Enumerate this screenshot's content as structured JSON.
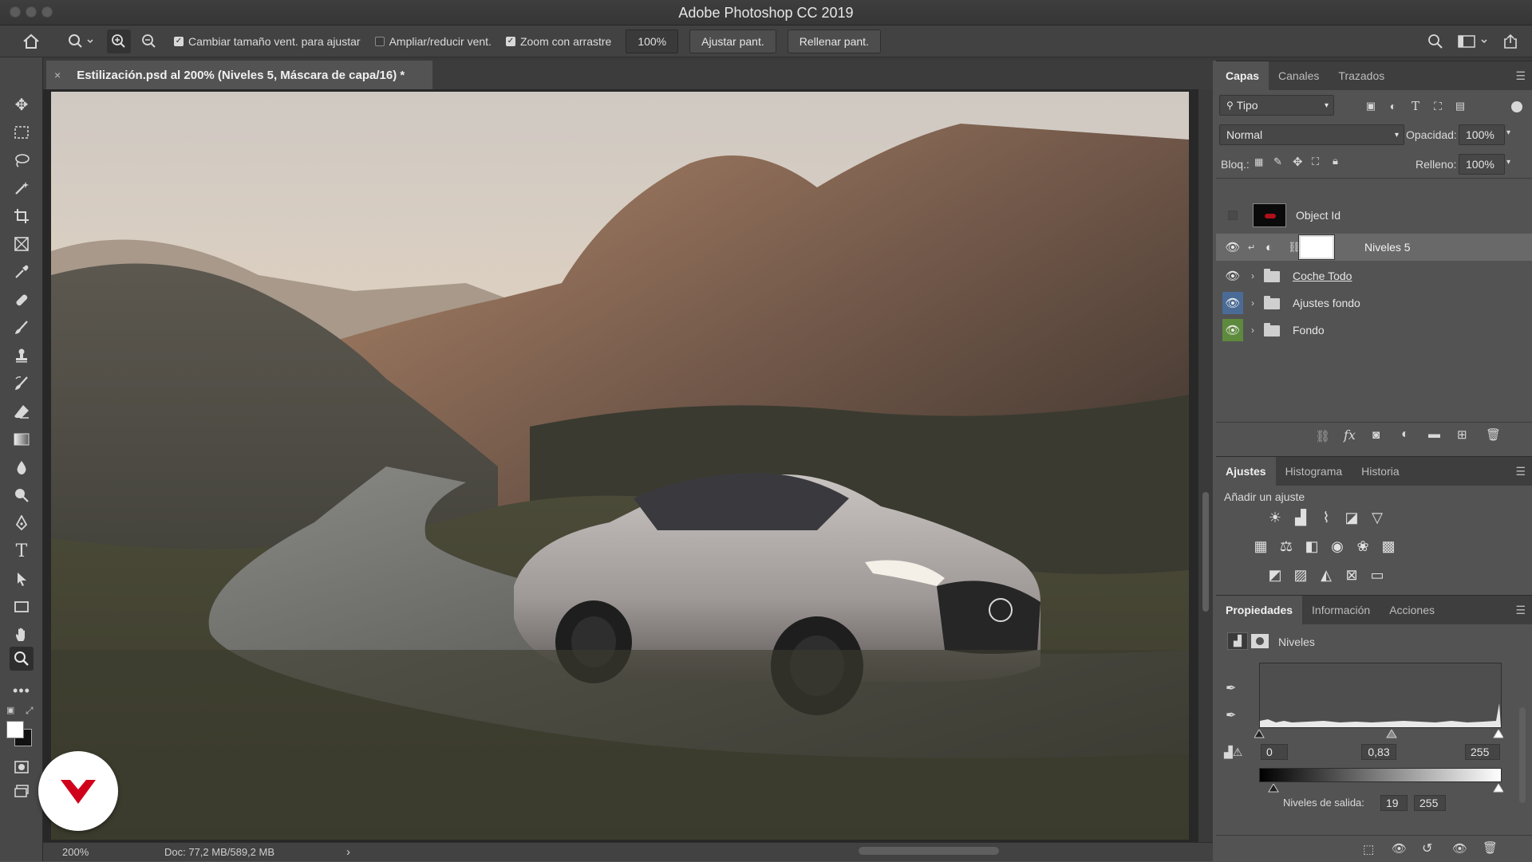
{
  "window": {
    "title": "Adobe Photoshop CC 2019"
  },
  "options_bar": {
    "resize_windows_label": "Cambiar tamaño vent. para ajustar",
    "resize_windows_checked": true,
    "zoom_all_label": "Ampliar/reducir vent.",
    "zoom_all_checked": false,
    "scrubby_zoom_label": "Zoom con arrastre",
    "scrubby_zoom_checked": true,
    "zoom_value": "100%",
    "fit_screen_label": "Ajustar pant.",
    "fill_screen_label": "Rellenar pant."
  },
  "document": {
    "tab_title": "Estilización.psd al 200% (Niveles 5, Máscara de capa/16) *",
    "close_glyph": "×"
  },
  "status": {
    "zoom": "200%",
    "doc_size": "Doc: 77,2 MB/589,2 MB",
    "arrow": "›"
  },
  "layers_panel": {
    "tabs": [
      "Capas",
      "Canales",
      "Trazados"
    ],
    "active_tab": "Capas",
    "filter_kind": "Tipo",
    "blend_mode": "Normal",
    "opacity_label": "Opacidad:",
    "opacity_value": "100%",
    "lock_label": "Bloq.:",
    "fill_label": "Relleno:",
    "fill_value": "100%",
    "layers": [
      {
        "name": "Object Id",
        "visible": false,
        "type": "smart"
      },
      {
        "name": "Niveles 5",
        "visible": true,
        "type": "adjustment",
        "selected": true
      },
      {
        "name": "Coche Todo",
        "visible": true,
        "type": "group"
      },
      {
        "name": "Ajustes fondo",
        "visible": true,
        "type": "group",
        "eye_color": "#4a6b96"
      },
      {
        "name": "Fondo",
        "visible": true,
        "type": "group",
        "eye_color": "#5d8a3c"
      }
    ]
  },
  "adjustments_panel": {
    "tabs": [
      "Ajustes",
      "Histograma",
      "Historia"
    ],
    "active_tab": "Ajustes",
    "add_label": "Añadir un ajuste"
  },
  "properties_panel": {
    "tabs": [
      "Propiedades",
      "Información",
      "Acciones"
    ],
    "active_tab": "Propiedades",
    "title": "Niveles",
    "input_black": "0",
    "input_gamma": "0,83",
    "input_white": "255",
    "output_label": "Niveles de salida:",
    "output_black": "19",
    "output_white": "255"
  },
  "colors": {
    "selected_layer": "#696969",
    "panel_bg": "#535353",
    "brand": "#d0021b"
  }
}
